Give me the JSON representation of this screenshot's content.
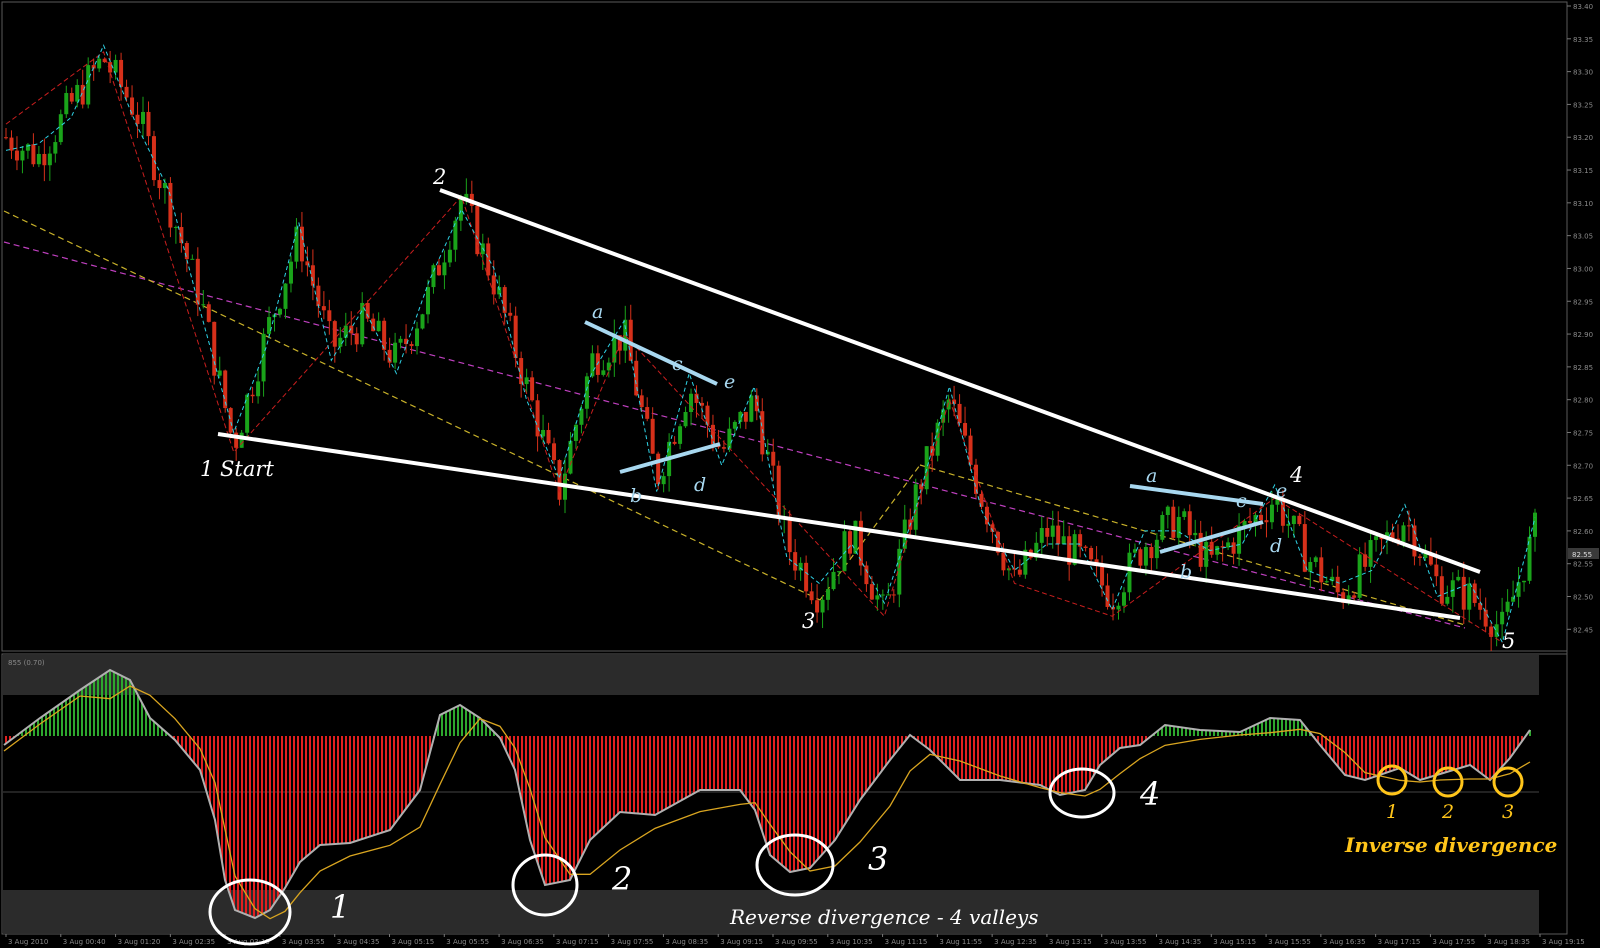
{
  "chart_data": [
    {
      "type": "candlestick",
      "symbol": "",
      "y_ticks": [
        "83.40",
        "83.35",
        "83.30",
        "83.25",
        "83.20",
        "83.15",
        "83.10",
        "83.05",
        "83.00",
        "82.95",
        "82.90",
        "82.85",
        "82.80",
        "82.75",
        "82.70",
        "82.65",
        "82.60",
        "82.55",
        "82.50",
        "82.45"
      ],
      "current_price_label": "82.55",
      "ylim": [
        82.42,
        83.4
      ],
      "grid": false,
      "wave_labels": [
        {
          "text": "1 Start",
          "price": 82.72,
          "x_time_index": 1
        },
        {
          "text": "2",
          "price": 83.11,
          "x_time_index": 5
        },
        {
          "text": "3",
          "price": 82.47,
          "x_time_index": 12
        },
        {
          "text": "4",
          "price": 82.65,
          "x_time_index": 19
        },
        {
          "text": "5",
          "price": 82.43,
          "x_time_index": 22
        }
      ],
      "sub_wave_labels_left": [
        "a",
        "b",
        "c",
        "d",
        "e"
      ],
      "sub_wave_labels_right": [
        "a",
        "b",
        "c",
        "d",
        "e"
      ],
      "series_close_path": [
        [
          0,
          83.2
        ],
        [
          1,
          83.17
        ],
        [
          2,
          83.25
        ],
        [
          3,
          83.32
        ],
        [
          4,
          83.24
        ],
        [
          5,
          83.1
        ],
        [
          6,
          82.95
        ],
        [
          7,
          82.73
        ],
        [
          8,
          82.9
        ],
        [
          9,
          83.05
        ],
        [
          10,
          82.88
        ],
        [
          11,
          82.92
        ],
        [
          12,
          82.86
        ],
        [
          13,
          82.96
        ],
        [
          14,
          83.11
        ],
        [
          15,
          82.98
        ],
        [
          16,
          82.82
        ],
        [
          17,
          82.66
        ],
        [
          18,
          82.86
        ],
        [
          19,
          82.9
        ],
        [
          20,
          82.68
        ],
        [
          21,
          82.82
        ],
        [
          22,
          82.72
        ],
        [
          23,
          82.8
        ],
        [
          24,
          82.58
        ],
        [
          25,
          82.5
        ],
        [
          26,
          82.6
        ],
        [
          27,
          82.47
        ],
        [
          28,
          82.66
        ],
        [
          29,
          82.8
        ],
        [
          30,
          82.65
        ],
        [
          31,
          82.52
        ],
        [
          32,
          82.6
        ],
        [
          33,
          82.56
        ],
        [
          34,
          82.5
        ],
        [
          35,
          82.58
        ],
        [
          36,
          82.62
        ],
        [
          37,
          82.55
        ],
        [
          38,
          82.6
        ],
        [
          39,
          82.65
        ],
        [
          40,
          82.56
        ],
        [
          41,
          82.5
        ],
        [
          42,
          82.56
        ],
        [
          43,
          82.62
        ],
        [
          44,
          82.52
        ],
        [
          45,
          82.5
        ],
        [
          46,
          82.45
        ],
        [
          47,
          82.6
        ]
      ]
    },
    {
      "type": "histogram-oscillator",
      "indicator_label": "855 (0.70)",
      "valley_labels": [
        "1",
        "2",
        "3",
        "4"
      ],
      "inverse_labels": [
        "1",
        "2",
        "3"
      ],
      "annotation_reverse": "Reverse divergence - 4 valleys",
      "annotation_inverse": "Inverse divergence",
      "colors": {
        "positive": "#2ea82e",
        "negative": "#e02020",
        "signal": "#d9a520",
        "main": "#b0b0b0",
        "highlight": "#ffc51a"
      }
    }
  ],
  "x_ticks": [
    "3 Aug 2010",
    "3 Aug 00:40",
    "3 Aug 01:20",
    "3 Aug 02:35",
    "3 Aug 03:15",
    "3 Aug 03:55",
    "3 Aug 04:35",
    "3 Aug 05:15",
    "3 Aug 05:55",
    "3 Aug 06:35",
    "3 Aug 07:15",
    "3 Aug 07:55",
    "3 Aug 08:35",
    "3 Aug 09:15",
    "3 Aug 09:55",
    "3 Aug 10:35",
    "3 Aug 11:15",
    "3 Aug 11:55",
    "3 Aug 12:35",
    "3 Aug 13:15",
    "3 Aug 13:55",
    "3 Aug 14:35",
    "3 Aug 15:15",
    "3 Aug 15:55",
    "3 Aug 16:35",
    "3 Aug 17:15",
    "3 Aug 17:55",
    "3 Aug 18:35",
    "3 Aug 19:15"
  ],
  "colors": {
    "background": "#000000",
    "bull_candle": "#1aa31a",
    "bear_candle": "#d6301a",
    "trend_white": "#ffffff",
    "triangle_blue": "#a8d8f0",
    "zigzag_red": "#c81e1e",
    "zigzag_cyan": "#2fd3e6",
    "magenta_line": "#c040c0",
    "yellow_line": "#c9b22a"
  }
}
